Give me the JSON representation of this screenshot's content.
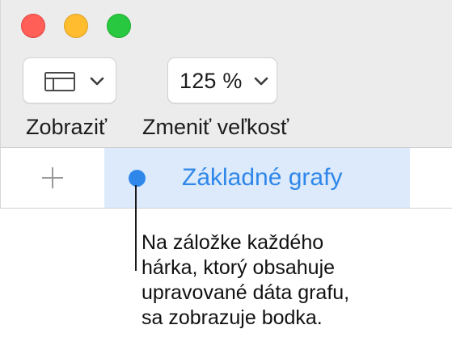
{
  "toolbar": {
    "view_button": {
      "icon": "sidebar-view-icon",
      "chevron": "chevron-down-icon"
    },
    "view_label": "Zobraziť",
    "zoom_button": {
      "value": "125 %",
      "chevron": "chevron-down-icon"
    },
    "zoom_label": "Zmeniť veľkosť"
  },
  "tabs": {
    "add_icon": "plus-icon",
    "items": [
      {
        "label": "Základné grafy",
        "has_dot": true
      }
    ]
  },
  "callout": {
    "lines": [
      "Na záložke každého",
      "hárka, ktorý obsahuje",
      "upravované dáta grafu,",
      "sa zobrazuje bodka."
    ]
  },
  "colors": {
    "accent": "#2f87ea",
    "tab_selected_bg": "#dceafb",
    "close": "#ff5f57",
    "minimize": "#febc2e",
    "zoom": "#28c840"
  }
}
